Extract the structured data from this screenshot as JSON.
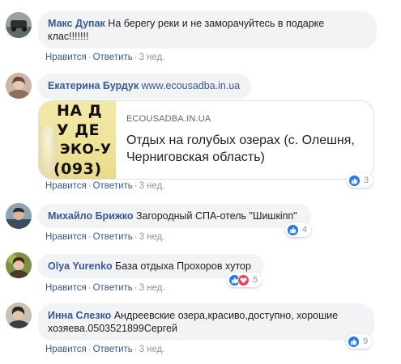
{
  "colors": {
    "link": "#385898",
    "bubble": "#f2f3f5",
    "meta": "#90949c",
    "like": "#2078f4",
    "love": "#f33e58"
  },
  "comments": [
    {
      "author": "Макс Дупак",
      "text": "На берегу реки и не заморачуйтесь в подарке клас!!!!!!!",
      "actions": {
        "like": "Нравится",
        "reply": "Ответить",
        "time": "3 нед."
      }
    },
    {
      "author": "Екатерина Бурдук",
      "link": "www.ecousadba.in.ua",
      "preview": {
        "thumb_text": [
          "НА Д",
          "У ДЕ",
          "ЭКО-У",
          "(093)"
        ],
        "domain": "ECOUSADBA.IN.UA",
        "title": "Отдых на голубых озерах (с. Олешня, Черниговская область)"
      },
      "reactions": {
        "count": "3",
        "icons": [
          "like-icon"
        ]
      },
      "actions": {
        "like": "Нравится",
        "reply": "Ответить",
        "time": "3 нед."
      }
    },
    {
      "author": "Михайло Брижко",
      "text": "Загородный СПА-отель \"Шишкіпп\"",
      "reactions": {
        "count": "4",
        "icons": [
          "like-icon"
        ]
      },
      "actions": {
        "like": "Нравится",
        "reply": "Ответить",
        "time": "3 нед."
      }
    },
    {
      "author": "Olya Yurenko",
      "text": "База отдыха Прохоров хутор",
      "reactions": {
        "count": "5",
        "icons": [
          "like-icon",
          "love-icon"
        ]
      },
      "actions": {
        "like": "Нравится",
        "reply": "Ответить",
        "time": "3 нед."
      }
    },
    {
      "author": "Инна Слезко",
      "text": "Андреевские озера,красиво,доступно, хорошие хозяева.0503521899Сергей",
      "reactions": {
        "count": "9",
        "icons": [
          "like-icon"
        ]
      },
      "actions": {
        "like": "Нравится",
        "reply": "Ответить",
        "time": "3 нед."
      }
    }
  ]
}
